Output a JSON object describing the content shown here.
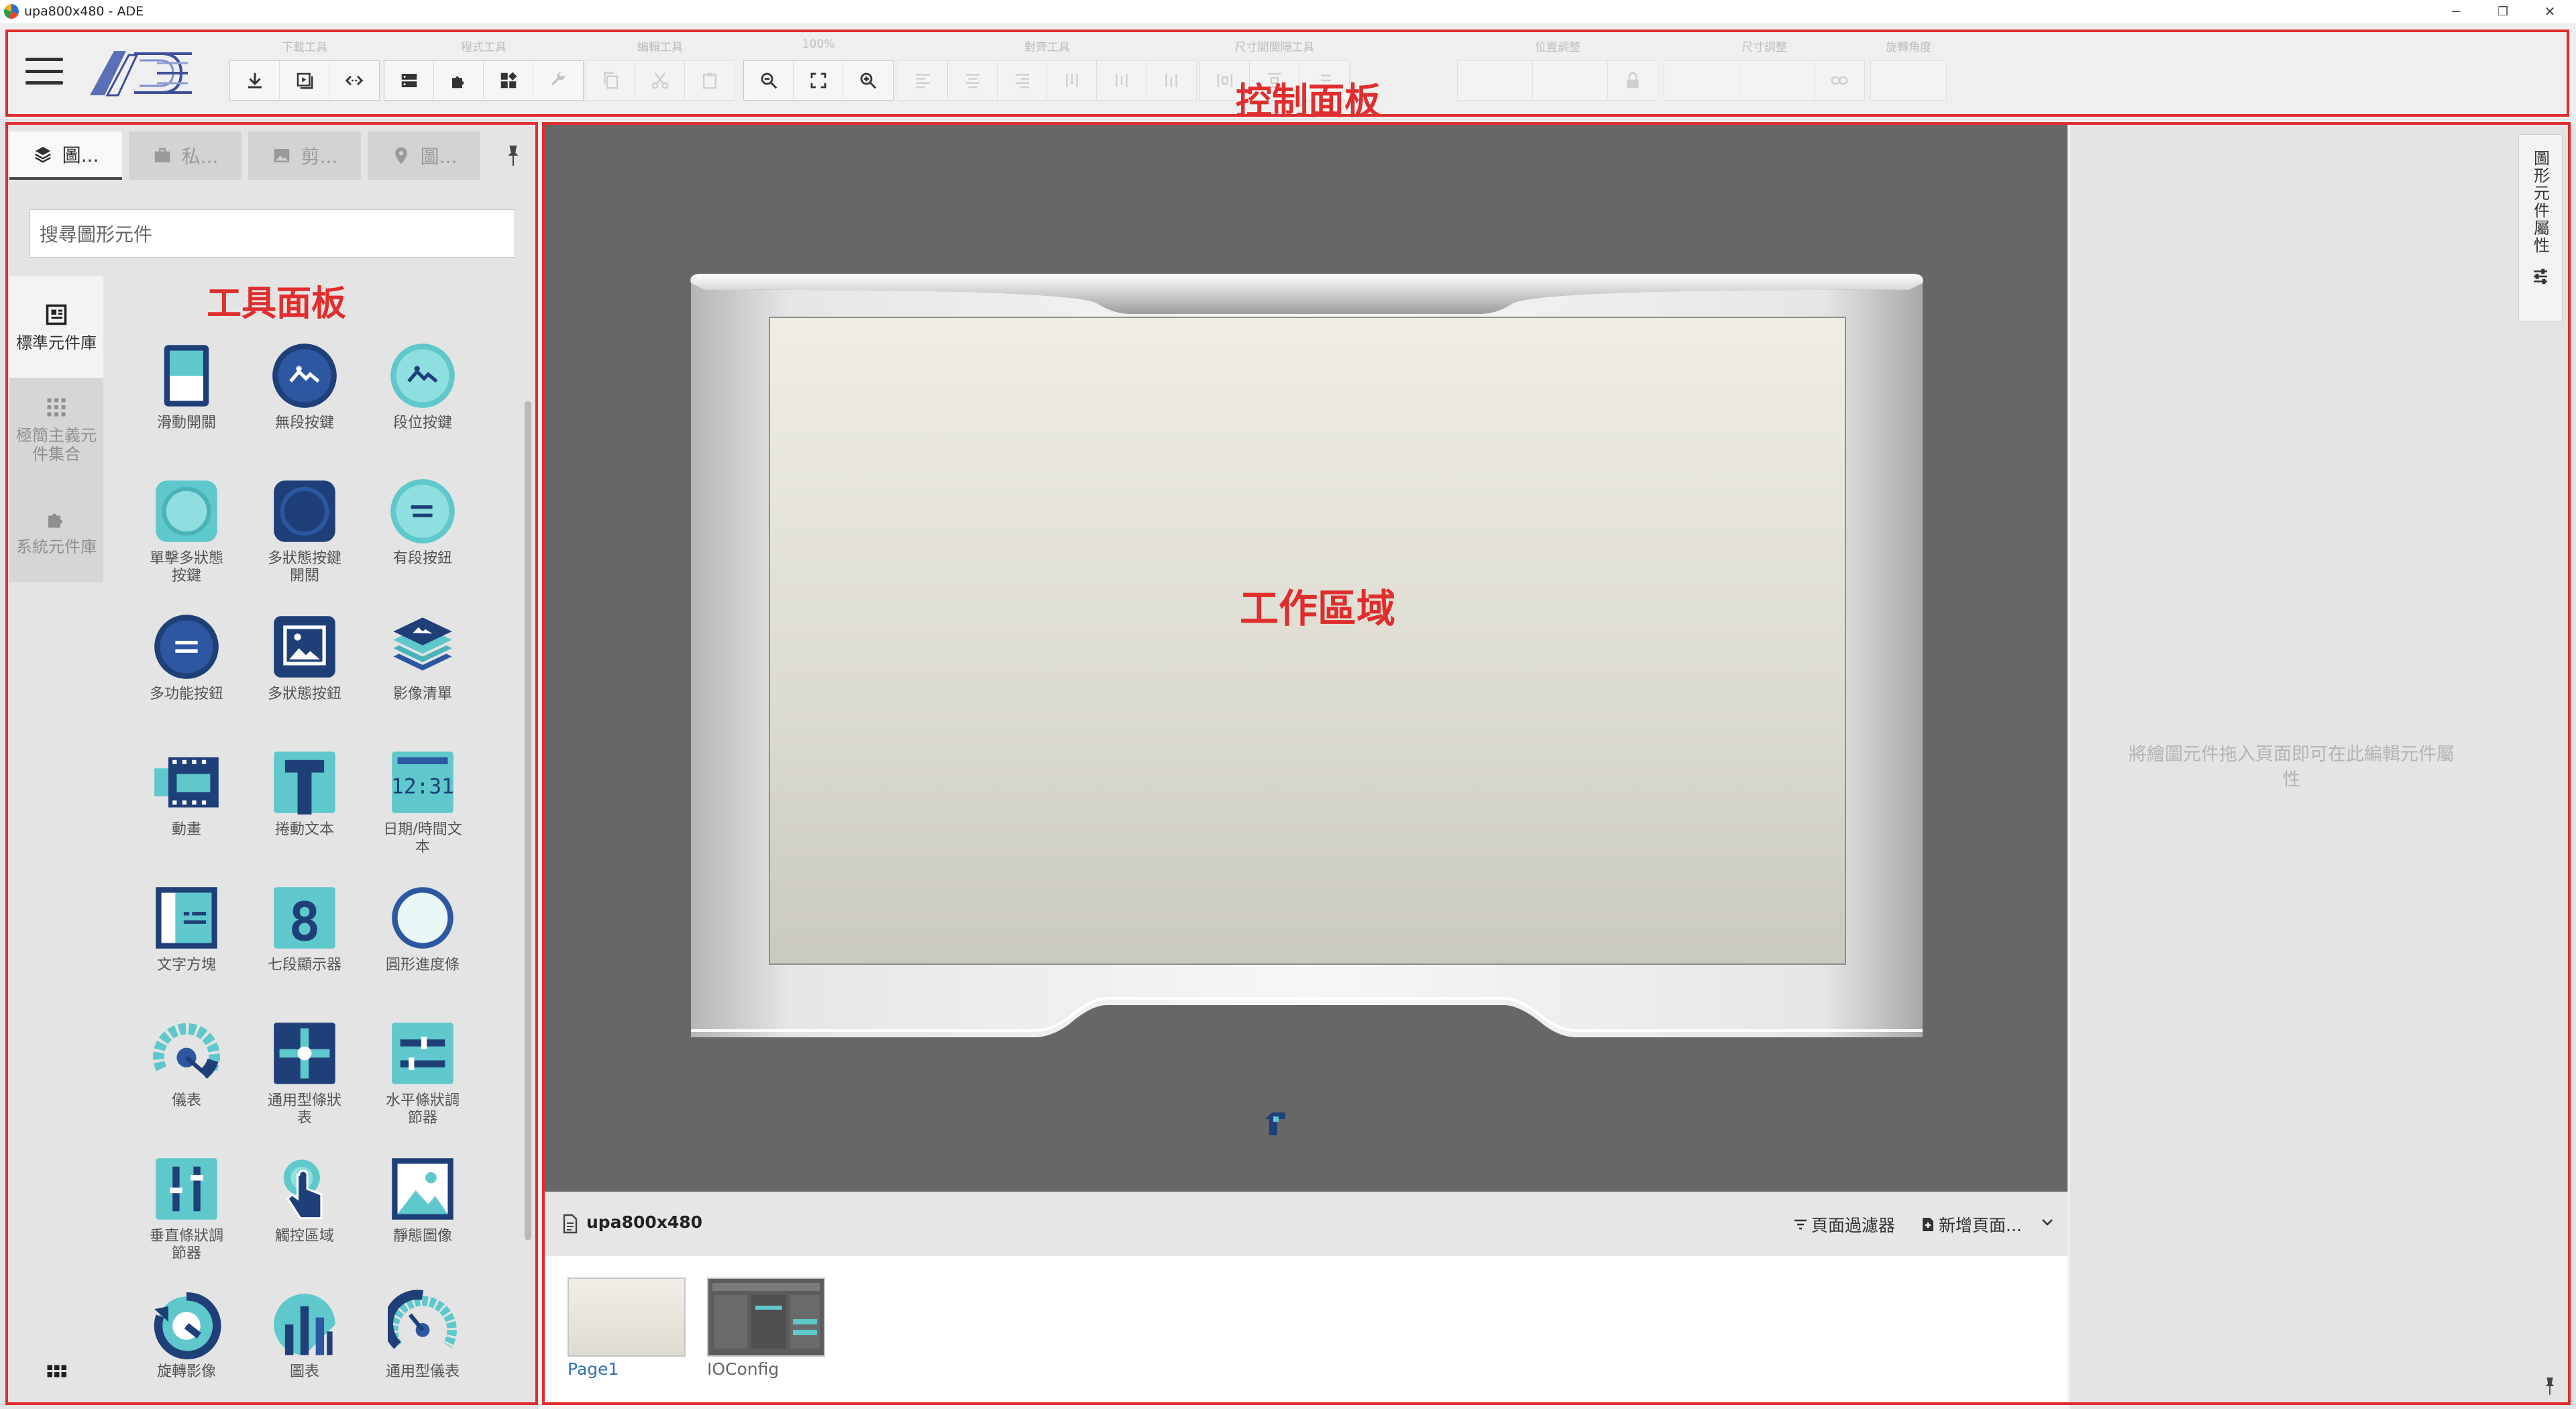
{
  "window": {
    "title": "upa800x480 - ADE",
    "minimize": "─",
    "restore": "❐",
    "close": "✕"
  },
  "annotations": {
    "control_panel": "控制面板",
    "tool_panel": "工具面板",
    "work_area": "工作區域"
  },
  "toolbar": {
    "groups": [
      "下載工具",
      "程式工具",
      "編輯工具",
      "100%",
      "對齊工具",
      "尺寸間間隔工具",
      "位置調整",
      "尺寸調整",
      "旋轉角度"
    ]
  },
  "left_panel": {
    "tabs": [
      {
        "label": "圖...",
        "icon": "layers-icon"
      },
      {
        "label": "私...",
        "icon": "briefcase-icon"
      },
      {
        "label": "剪...",
        "icon": "image-icon"
      },
      {
        "label": "圖...",
        "icon": "map-pin-icon"
      }
    ],
    "search_placeholder": "搜尋圖形元件",
    "categories": [
      {
        "label": "標準元件庫",
        "icon": "widget-icon"
      },
      {
        "label": "極簡主義元件集合",
        "icon": "grid-dots-icon"
      },
      {
        "label": "系統元件庫",
        "icon": "puzzle-icon"
      }
    ],
    "components": [
      "滑動開關",
      "無段按鍵",
      "段位按鍵",
      "單擊多狀態按鍵",
      "多狀態按鍵開關",
      "有段按鈕",
      "多功能按鈕",
      "多狀態按鈕",
      "影像清單",
      "動畫",
      "捲動文本",
      "日期/時間文本",
      "文字方塊",
      "七段顯示器",
      "圓形進度條",
      "儀表",
      "通用型條狀表",
      "水平條狀調節器",
      "垂直條狀調節器",
      "觸控區域",
      "靜態圖像",
      "旋轉影像",
      "圖表",
      "通用型儀表"
    ],
    "seven_seg_digit": "8",
    "datetime_sample": "12:31"
  },
  "page_bar": {
    "project_name": "upa800x480",
    "filter_label": "頁面過濾器",
    "add_page_label": "新增頁面..."
  },
  "pages": [
    {
      "label": "Page1"
    },
    {
      "label": "IOConfig"
    }
  ],
  "properties_panel": {
    "empty_hint": "將繪圖元件拖入頁面即可在此編輯元件屬性",
    "tab_label": "圖形元件屬性"
  },
  "colors": {
    "annotation_red": "#e02d2d",
    "icon_navy": "#1f3f78",
    "icon_teal": "#5ec8cc",
    "link_blue": "#2f6fb5"
  }
}
